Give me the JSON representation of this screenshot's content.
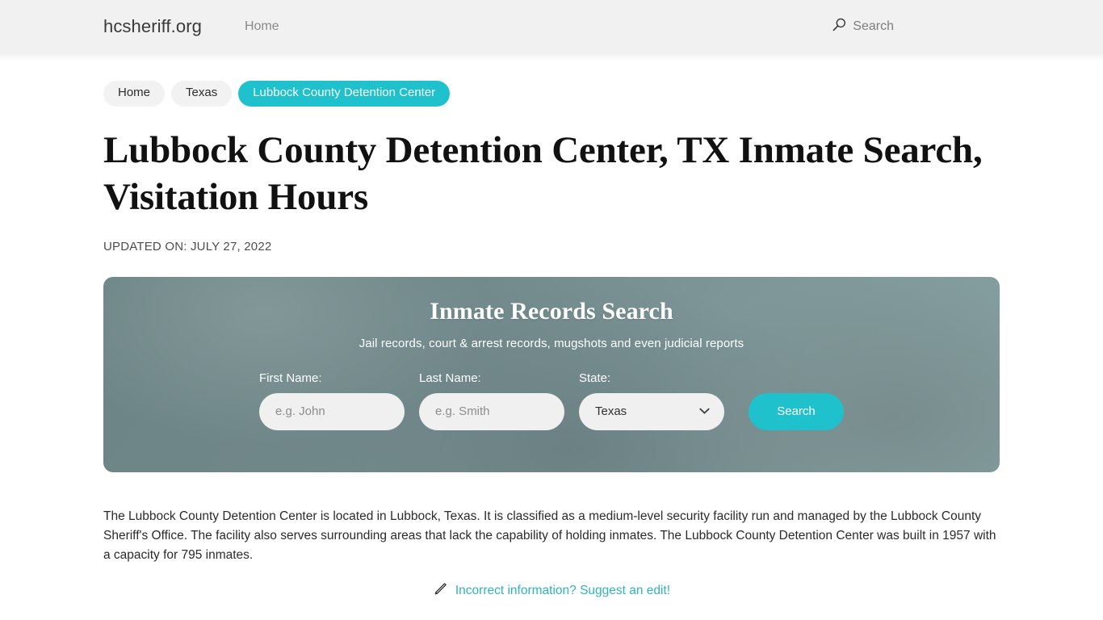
{
  "header": {
    "brand": "hcsheriff.org",
    "nav": [
      {
        "label": "Home"
      }
    ],
    "search": {
      "label": "Search",
      "icon": "search-icon"
    }
  },
  "breadcrumb": {
    "items": [
      {
        "label": "Home",
        "active": false
      },
      {
        "label": "Texas",
        "active": false
      },
      {
        "label": "Lubbock County Detention Center",
        "active": true
      }
    ]
  },
  "main": {
    "title": "Lubbock County Detention Center, TX Inmate Search, Visitation Hours",
    "updated": "UPDATED ON: JULY 27, 2022",
    "paragraph": "The Lubbock County Detention Center is located in Lubbock, Texas. It is classified as a medium-level security facility run and managed by the Lubbock County Sheriff's Office. The facility also serves surrounding areas that lack the capability of holding inmates. The Lubbock County Detention Center was built in 1957 with a capacity for 795 inmates.",
    "suggest": {
      "icon": "pencil-icon",
      "link_text": "Incorrect information? Suggest an edit!"
    }
  },
  "search_widget": {
    "title": "Inmate Records Search",
    "subtitle": "Jail records, court & arrest records, mugshots and even judicial reports",
    "fields": {
      "first_name": {
        "label": "First Name:",
        "placeholder": "e.g. John",
        "value": ""
      },
      "last_name": {
        "label": "Last Name:",
        "placeholder": "e.g. Smith",
        "value": ""
      },
      "state": {
        "label": "State:",
        "selected": "Texas",
        "options": [
          "Texas"
        ]
      }
    },
    "submit_label": "Search"
  },
  "colors": {
    "accent_teal": "#1fc1cc",
    "link_teal": "#2fb4bd",
    "header_bg": "#f1f1f1",
    "pill_bg": "#f2f2f2",
    "input_bg": "#f0f0f0",
    "banner_gradient_from": "#6d8486",
    "banner_gradient_to": "#86a0a1"
  }
}
